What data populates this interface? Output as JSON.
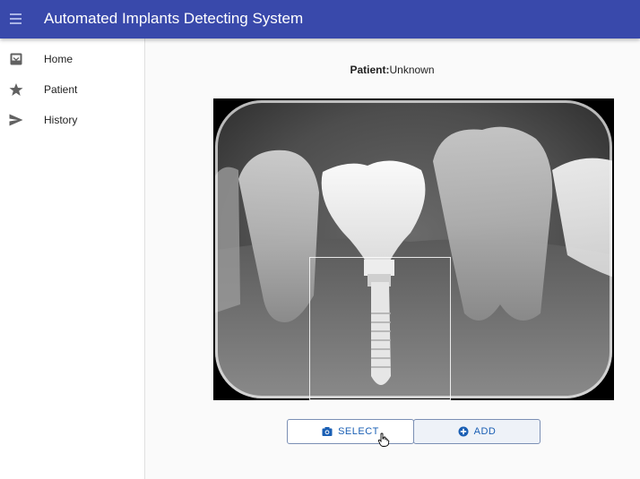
{
  "app": {
    "title": "Automated Implants Detecting System",
    "menu_icon": "hamburger-menu-icon",
    "appbar_color": "#3949ab"
  },
  "sidebar": {
    "items": [
      {
        "label": "Home",
        "icon": "inbox-icon"
      },
      {
        "label": "Patient",
        "icon": "star-icon"
      },
      {
        "label": "History",
        "icon": "send-icon"
      }
    ]
  },
  "main": {
    "patient_key": "Patient:",
    "patient_value": "Unknown",
    "image_alt": "Dental X-ray with detected implant",
    "buttons": {
      "select_label": "SELECT",
      "select_icon": "camera-icon",
      "add_label": "ADD",
      "add_icon": "add-circle-icon"
    },
    "accent_color": "#1a5fb4"
  }
}
